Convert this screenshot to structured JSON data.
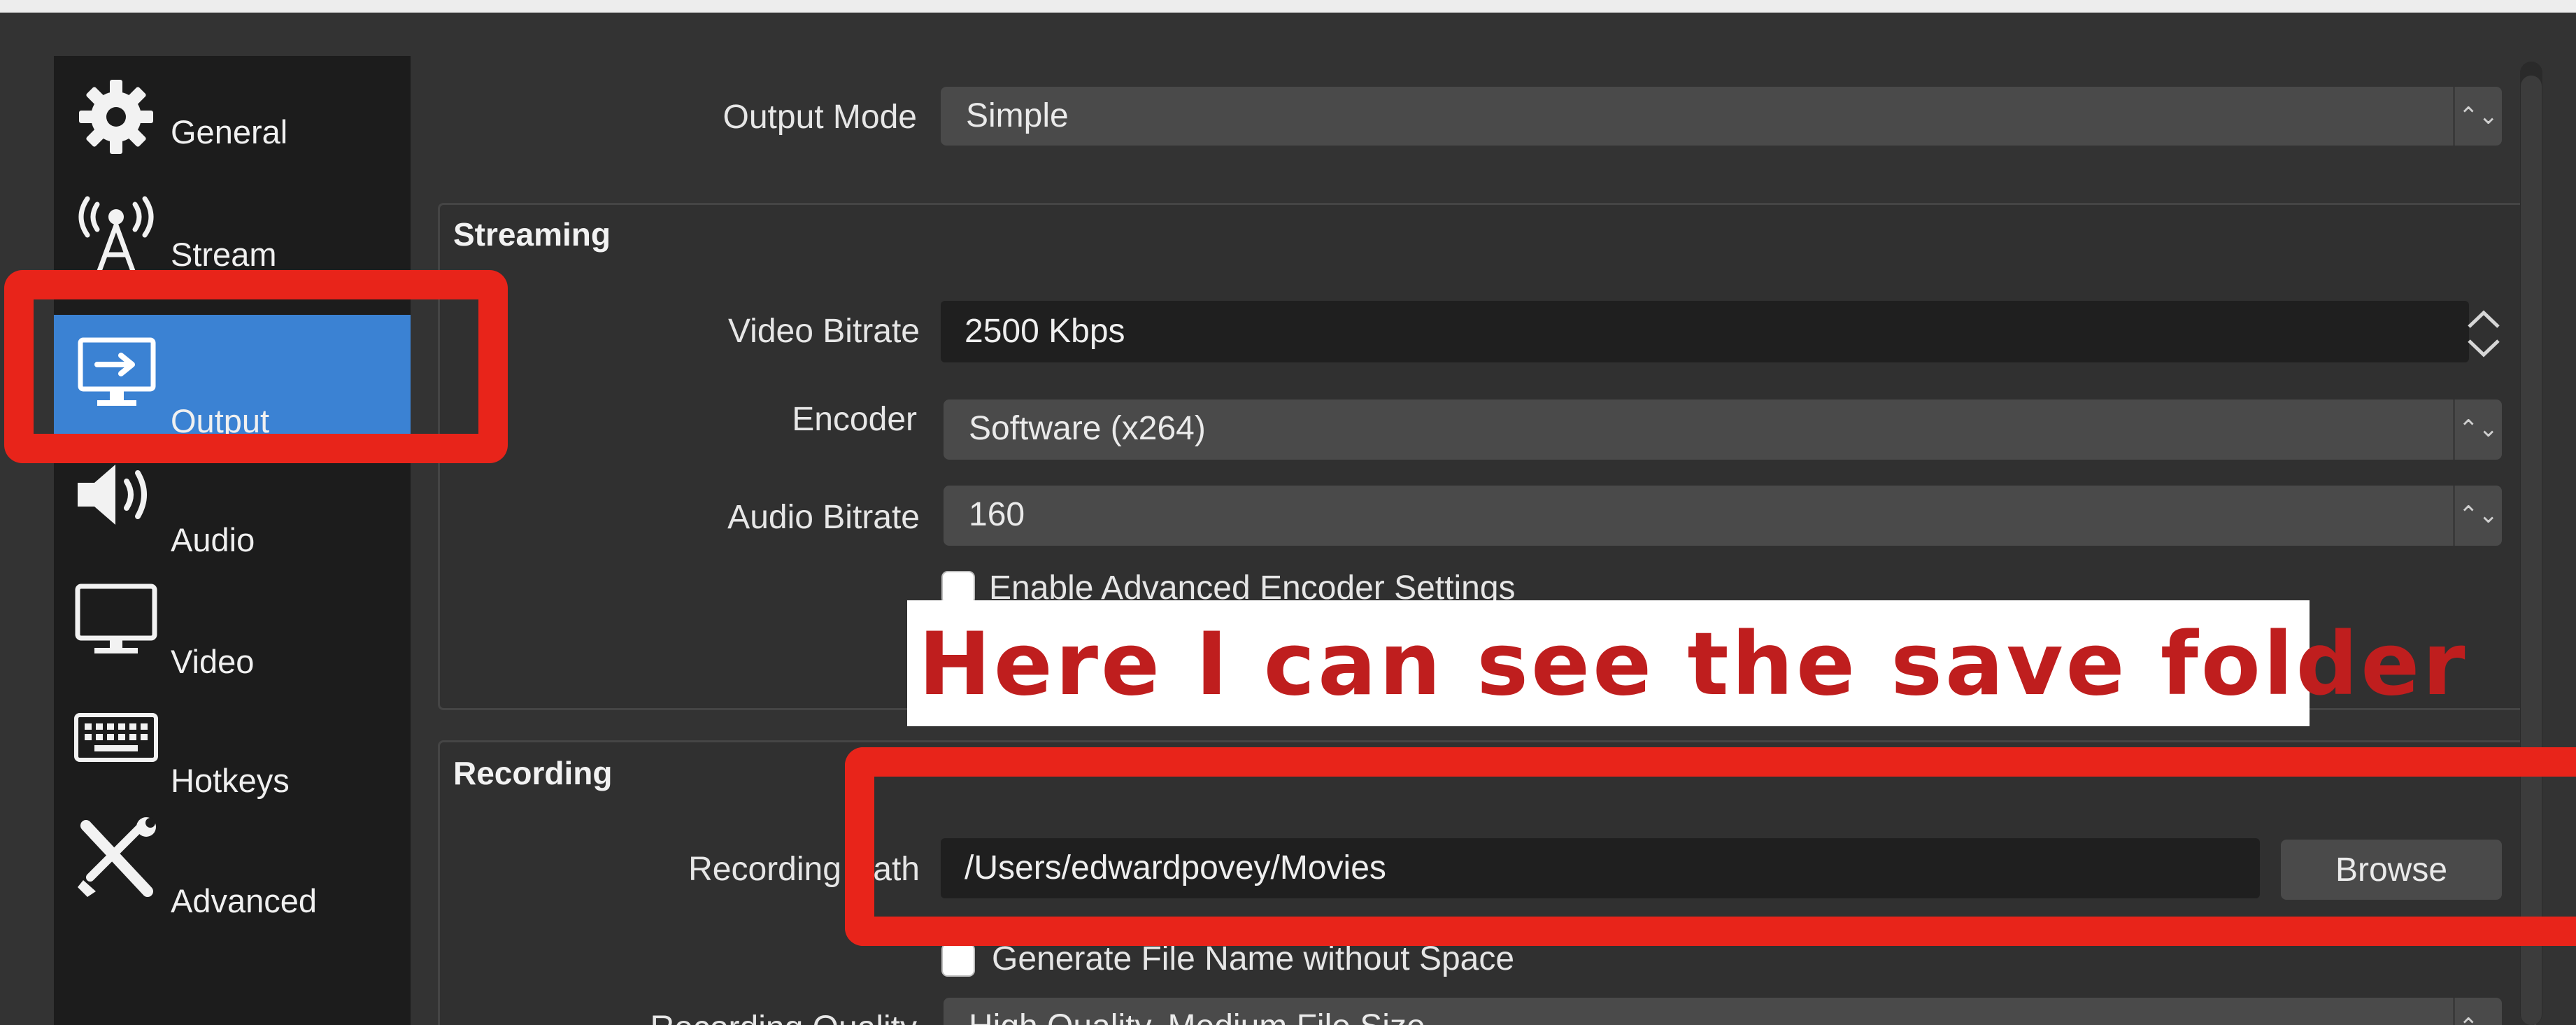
{
  "sidebar": {
    "items": [
      {
        "label": "General",
        "icon": "gear-icon"
      },
      {
        "label": "Stream",
        "icon": "antenna-icon"
      },
      {
        "label": "Output",
        "icon": "output-monitor-icon",
        "active": true
      },
      {
        "label": "Audio",
        "icon": "speaker-icon"
      },
      {
        "label": "Video",
        "icon": "monitor-icon"
      },
      {
        "label": "Hotkeys",
        "icon": "keyboard-icon"
      },
      {
        "label": "Advanced",
        "icon": "tools-icon"
      }
    ]
  },
  "output_mode": {
    "label": "Output Mode",
    "value": "Simple"
  },
  "streaming": {
    "title": "Streaming",
    "video_bitrate": {
      "label": "Video Bitrate",
      "value": "2500 Kbps"
    },
    "encoder": {
      "label": "Encoder",
      "value": "Software (x264)"
    },
    "audio_bitrate": {
      "label": "Audio Bitrate",
      "value": "160"
    },
    "advanced_encoder": {
      "label": "Enable Advanced Encoder Settings",
      "checked": false
    }
  },
  "callout": {
    "text": "Here I can see the save folder"
  },
  "recording": {
    "title": "Recording",
    "path": {
      "label": "Recording Path",
      "value": "/Users/edwardpovey/Movies",
      "browse_label": "Browse"
    },
    "filename_no_space": {
      "label": "Generate File Name without Space",
      "checked": false
    },
    "quality": {
      "label": "Recording Quality",
      "value": "High Quality, Medium File Size"
    }
  },
  "colors": {
    "accent": "#3b82d3",
    "annotation": "#e8241a",
    "callout_text": "#bf1e1e"
  }
}
